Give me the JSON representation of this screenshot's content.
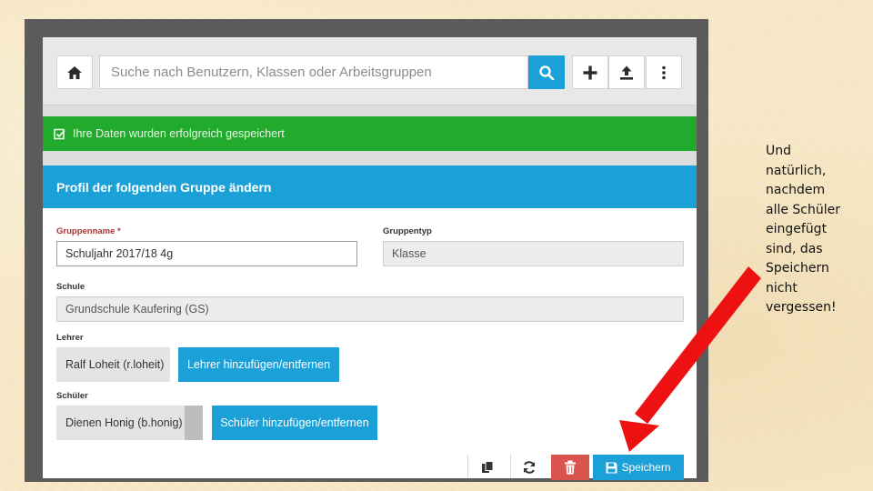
{
  "toolbar": {
    "search_placeholder": "Suche nach Benutzern, Klassen oder Arbeitsgruppen",
    "icons": [
      "home-icon",
      "search-icon",
      "plus-icon",
      "upload-icon",
      "more-vertical-icon"
    ]
  },
  "banner": {
    "message": "Ihre Daten wurden erfolgreich gespeichert",
    "color": "#21aa2b"
  },
  "panel": {
    "title": "Profil der folgenden Gruppe ändern",
    "accent_color": "#1ba1d8",
    "group_name": {
      "label": "Gruppenname *",
      "value": "Schuljahr 2017/18 4g"
    },
    "group_type": {
      "label": "Gruppentyp",
      "value": "Klasse"
    },
    "school": {
      "label": "Schule",
      "value": "Grundschule Kaufering (GS)"
    },
    "teacher": {
      "label": "Lehrer",
      "value": "Ralf Loheit (r.loheit)",
      "button": "Lehrer hinzufügen/entfernen"
    },
    "students": {
      "label": "Schüler",
      "value": "Dienen Honig (b.honig)",
      "button": "Schüler hinzufügen/entfernen"
    },
    "actions": {
      "icons": [
        "copy-icon",
        "refresh-icon",
        "trash-icon",
        "save-icon"
      ],
      "delete_color": "#d9534f",
      "save_label": "Speichern"
    }
  },
  "annotation": {
    "text": "Und\nnatürlich,\nnachdem\nalle Schüler\neingefügt\nsind, das\nSpeichern\nnicht\nvergessen!",
    "arrow_color": "#ee1111"
  }
}
